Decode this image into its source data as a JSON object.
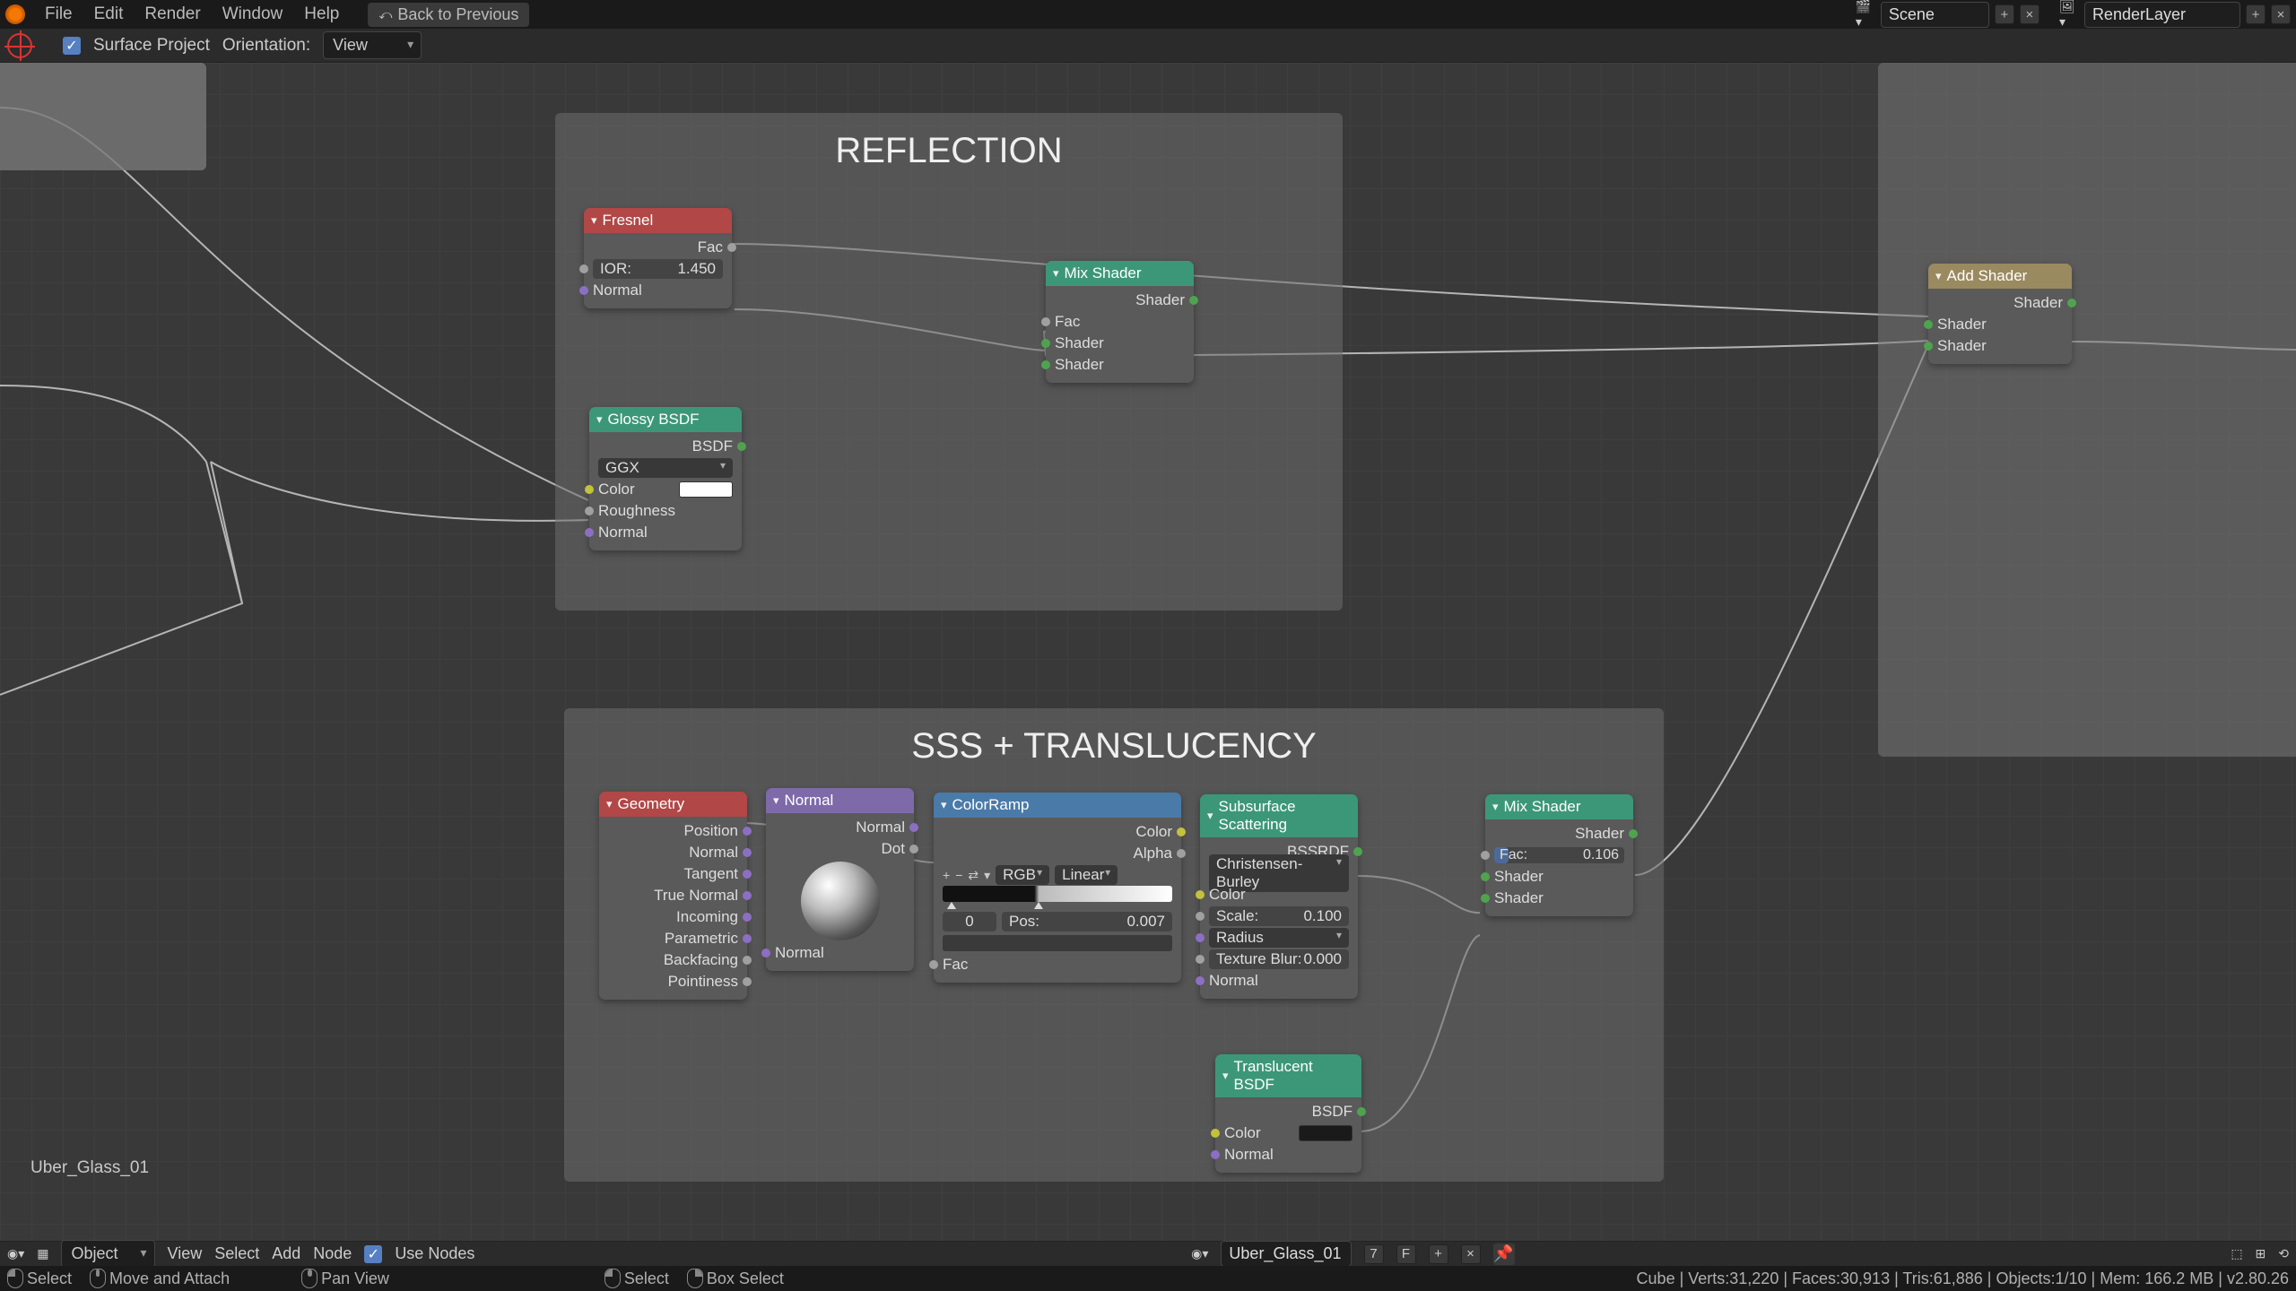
{
  "menu": {
    "file": "File",
    "edit": "Edit",
    "render": "Render",
    "window": "Window",
    "help": "Help",
    "back": "Back to Previous"
  },
  "topright": {
    "scene": "Scene",
    "render_layer": "RenderLayer"
  },
  "header": {
    "surface_project": "Surface Project",
    "orientation_lbl": "Orientation:",
    "orientation_val": "View"
  },
  "frames": {
    "reflection": "REFLECTION",
    "sss": "SSS + TRANSLUCENCY"
  },
  "nodes": {
    "fresnel": {
      "title": "Fresnel",
      "out_fac": "Fac",
      "ior_lbl": "IOR:",
      "ior_val": "1.450",
      "normal": "Normal"
    },
    "glossy": {
      "title": "Glossy BSDF",
      "out": "BSDF",
      "dist": "GGX",
      "color": "Color",
      "rough": "Roughness",
      "normal": "Normal"
    },
    "mix1": {
      "title": "Mix Shader",
      "out": "Shader",
      "fac": "Fac",
      "sh1": "Shader",
      "sh2": "Shader"
    },
    "add": {
      "title": "Add Shader",
      "out": "Shader",
      "sh1": "Shader",
      "sh2": "Shader"
    },
    "geometry": {
      "title": "Geometry",
      "position": "Position",
      "normal": "Normal",
      "tangent": "Tangent",
      "truenormal": "True Normal",
      "incoming": "Incoming",
      "parametric": "Parametric",
      "backfacing": "Backfacing",
      "pointiness": "Pointiness"
    },
    "normal": {
      "title": "Normal",
      "out_n": "Normal",
      "out_d": "Dot",
      "in": "Normal"
    },
    "colorramp": {
      "title": "ColorRamp",
      "out_color": "Color",
      "out_alpha": "Alpha",
      "mode1": "RGB",
      "mode2": "Linear",
      "index": "0",
      "pos_lbl": "Pos:",
      "pos_val": "0.007",
      "fac": "Fac"
    },
    "sss": {
      "title": "Subsurface Scattering",
      "out": "BSSRDF",
      "method": "Christensen-Burley",
      "color": "Color",
      "scale_lbl": "Scale:",
      "scale_val": "0.100",
      "radius": "Radius",
      "blur_lbl": "Texture Blur:",
      "blur_val": "0.000",
      "normal": "Normal"
    },
    "translucent": {
      "title": "Translucent BSDF",
      "out": "BSDF",
      "color": "Color",
      "normal": "Normal"
    },
    "mix2": {
      "title": "Mix Shader",
      "out": "Shader",
      "fac_lbl": "Fac:",
      "fac_val": "0.106",
      "sh1": "Shader",
      "sh2": "Shader"
    }
  },
  "material_name": "Uber_Glass_01",
  "footer": {
    "object_mode": "Object",
    "view": "View",
    "select": "Select",
    "add": "Add",
    "node": "Node",
    "use_nodes": "Use Nodes",
    "material": "Uber_Glass_01",
    "users": "7",
    "fake": "F"
  },
  "status": {
    "select": "Select",
    "move": "Move and Attach",
    "pan": "Pan View",
    "select2": "Select",
    "box": "Box Select",
    "stats": "Cube | Verts:31,220 | Faces:30,913 | Tris:61,886 | Objects:1/10 | Mem: 166.2 MB | v2.80.26"
  }
}
